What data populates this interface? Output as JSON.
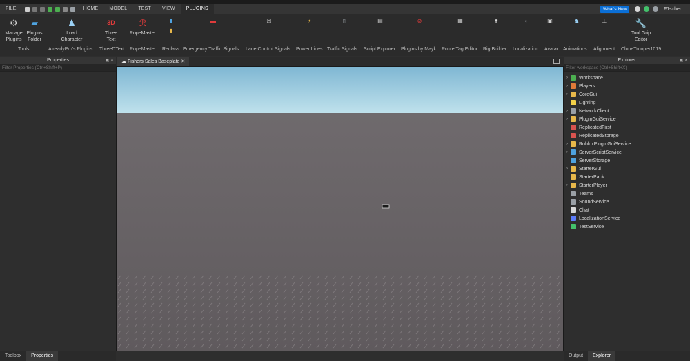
{
  "menu": {
    "file": "FILE",
    "tabs": [
      {
        "label": "HOME"
      },
      {
        "label": "MODEL"
      },
      {
        "label": "TEST"
      },
      {
        "label": "VIEW"
      },
      {
        "label": "PLUGINS"
      }
    ],
    "whats_new": "What's New",
    "user": "F1sxher"
  },
  "ribbon": {
    "buttons": {
      "manage_plugins": "Manage\nPlugins",
      "plugins_folder": "Plugins\nFolder",
      "load_character": "Load\nCharacter",
      "three_text": "Three\nText",
      "ropemaster": "RopeMaster",
      "tool_grip_editor": "Tool Grip\nEditor"
    },
    "groups": [
      "Tools",
      "AlreadyPro's Plugins",
      "ThreeDText",
      "RopeMaster",
      "Reclass",
      "Emergency Traffic Signals",
      "Lane Control Signals",
      "Power Lines",
      "Traffic Signals",
      "Script Explorer",
      "Plugins by Mayk",
      "Route Tag Editor",
      "Rig Builder",
      "Localization",
      "Avatar",
      "Animations",
      "Alignment",
      "CloneTrooper1019"
    ]
  },
  "properties": {
    "title": "Properties",
    "filter_placeholder": "Filter Properties (Ctrl+Shift+P)"
  },
  "document": {
    "tab_title": "Fishers Sales Baseplate"
  },
  "explorer": {
    "title": "Explorer",
    "filter_placeholder": "Filter workspace (Ctrl+Shift+X)",
    "items": [
      {
        "label": "Workspace",
        "icon": "globe-icon",
        "color": "#4caf50",
        "expandable": true
      },
      {
        "label": "Players",
        "icon": "players-icon",
        "color": "#e07b39",
        "expandable": true
      },
      {
        "label": "CoreGui",
        "icon": "folder-icon",
        "color": "#e8b84a",
        "expandable": true
      },
      {
        "label": "Lighting",
        "icon": "lightbulb-icon",
        "color": "#f2d049",
        "expandable": false
      },
      {
        "label": "NetworkClient",
        "icon": "network-icon",
        "color": "#9aa0a6",
        "expandable": true
      },
      {
        "label": "PluginGuiService",
        "icon": "folder-icon",
        "color": "#e8b84a",
        "expandable": true
      },
      {
        "label": "ReplicatedFirst",
        "icon": "replicated-icon",
        "color": "#d9534f",
        "expandable": false
      },
      {
        "label": "ReplicatedStorage",
        "icon": "replicated-icon",
        "color": "#d9534f",
        "expandable": false
      },
      {
        "label": "RobloxPluginGuiService",
        "icon": "folder-icon",
        "color": "#e8b84a",
        "expandable": true
      },
      {
        "label": "ServerScriptService",
        "icon": "script-service-icon",
        "color": "#4fa3e0",
        "expandable": true
      },
      {
        "label": "ServerStorage",
        "icon": "storage-icon",
        "color": "#4fa3e0",
        "expandable": false
      },
      {
        "label": "StarterGui",
        "icon": "folder-icon",
        "color": "#e8b84a",
        "expandable": true
      },
      {
        "label": "StarterPack",
        "icon": "folder-icon",
        "color": "#e8b84a",
        "expandable": false
      },
      {
        "label": "StarterPlayer",
        "icon": "folder-icon",
        "color": "#e8b84a",
        "expandable": true
      },
      {
        "label": "Teams",
        "icon": "teams-icon",
        "color": "#9aa0a6",
        "expandable": false
      },
      {
        "label": "SoundService",
        "icon": "sound-icon",
        "color": "#9aa0a6",
        "expandable": false
      },
      {
        "label": "Chat",
        "icon": "chat-icon",
        "color": "#d8d8d8",
        "expandable": false
      },
      {
        "label": "LocalizationService",
        "icon": "localization-icon",
        "color": "#5c7cfa",
        "expandable": false
      },
      {
        "label": "TestService",
        "icon": "test-icon",
        "color": "#43c16b",
        "expandable": false
      }
    ]
  },
  "bottom_tabs": {
    "left": [
      "Toolbox",
      "Properties"
    ],
    "right": [
      "Output",
      "Explorer"
    ]
  },
  "colors": {
    "accent": "#0b6fd6",
    "sky_top": "#7fb7d3",
    "sky_bottom": "#b9dde9",
    "baseplate": "#6b6669"
  }
}
